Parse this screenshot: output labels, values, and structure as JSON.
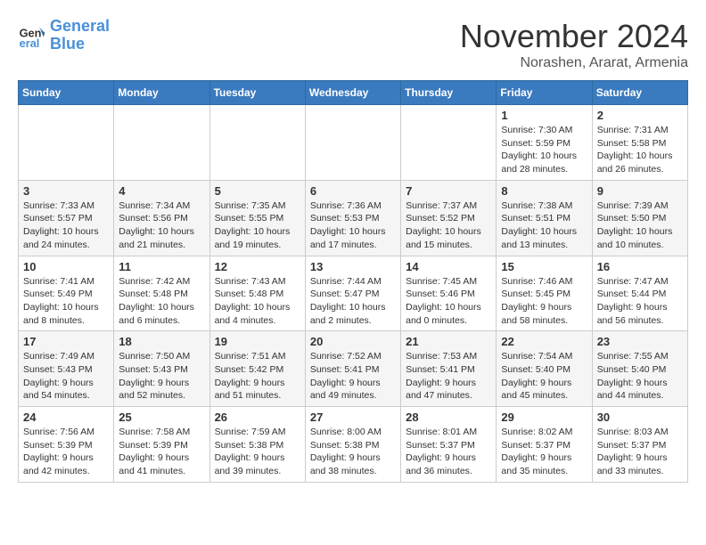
{
  "logo": {
    "line1": "General",
    "line2": "Blue"
  },
  "title": "November 2024",
  "location": "Norashen, Ararat, Armenia",
  "days_header": [
    "Sunday",
    "Monday",
    "Tuesday",
    "Wednesday",
    "Thursday",
    "Friday",
    "Saturday"
  ],
  "weeks": [
    [
      {
        "day": "",
        "info": ""
      },
      {
        "day": "",
        "info": ""
      },
      {
        "day": "",
        "info": ""
      },
      {
        "day": "",
        "info": ""
      },
      {
        "day": "",
        "info": ""
      },
      {
        "day": "1",
        "info": "Sunrise: 7:30 AM\nSunset: 5:59 PM\nDaylight: 10 hours\nand 28 minutes."
      },
      {
        "day": "2",
        "info": "Sunrise: 7:31 AM\nSunset: 5:58 PM\nDaylight: 10 hours\nand 26 minutes."
      }
    ],
    [
      {
        "day": "3",
        "info": "Sunrise: 7:33 AM\nSunset: 5:57 PM\nDaylight: 10 hours\nand 24 minutes."
      },
      {
        "day": "4",
        "info": "Sunrise: 7:34 AM\nSunset: 5:56 PM\nDaylight: 10 hours\nand 21 minutes."
      },
      {
        "day": "5",
        "info": "Sunrise: 7:35 AM\nSunset: 5:55 PM\nDaylight: 10 hours\nand 19 minutes."
      },
      {
        "day": "6",
        "info": "Sunrise: 7:36 AM\nSunset: 5:53 PM\nDaylight: 10 hours\nand 17 minutes."
      },
      {
        "day": "7",
        "info": "Sunrise: 7:37 AM\nSunset: 5:52 PM\nDaylight: 10 hours\nand 15 minutes."
      },
      {
        "day": "8",
        "info": "Sunrise: 7:38 AM\nSunset: 5:51 PM\nDaylight: 10 hours\nand 13 minutes."
      },
      {
        "day": "9",
        "info": "Sunrise: 7:39 AM\nSunset: 5:50 PM\nDaylight: 10 hours\nand 10 minutes."
      }
    ],
    [
      {
        "day": "10",
        "info": "Sunrise: 7:41 AM\nSunset: 5:49 PM\nDaylight: 10 hours\nand 8 minutes."
      },
      {
        "day": "11",
        "info": "Sunrise: 7:42 AM\nSunset: 5:48 PM\nDaylight: 10 hours\nand 6 minutes."
      },
      {
        "day": "12",
        "info": "Sunrise: 7:43 AM\nSunset: 5:48 PM\nDaylight: 10 hours\nand 4 minutes."
      },
      {
        "day": "13",
        "info": "Sunrise: 7:44 AM\nSunset: 5:47 PM\nDaylight: 10 hours\nand 2 minutes."
      },
      {
        "day": "14",
        "info": "Sunrise: 7:45 AM\nSunset: 5:46 PM\nDaylight: 10 hours\nand 0 minutes."
      },
      {
        "day": "15",
        "info": "Sunrise: 7:46 AM\nSunset: 5:45 PM\nDaylight: 9 hours\nand 58 minutes."
      },
      {
        "day": "16",
        "info": "Sunrise: 7:47 AM\nSunset: 5:44 PM\nDaylight: 9 hours\nand 56 minutes."
      }
    ],
    [
      {
        "day": "17",
        "info": "Sunrise: 7:49 AM\nSunset: 5:43 PM\nDaylight: 9 hours\nand 54 minutes."
      },
      {
        "day": "18",
        "info": "Sunrise: 7:50 AM\nSunset: 5:43 PM\nDaylight: 9 hours\nand 52 minutes."
      },
      {
        "day": "19",
        "info": "Sunrise: 7:51 AM\nSunset: 5:42 PM\nDaylight: 9 hours\nand 51 minutes."
      },
      {
        "day": "20",
        "info": "Sunrise: 7:52 AM\nSunset: 5:41 PM\nDaylight: 9 hours\nand 49 minutes."
      },
      {
        "day": "21",
        "info": "Sunrise: 7:53 AM\nSunset: 5:41 PM\nDaylight: 9 hours\nand 47 minutes."
      },
      {
        "day": "22",
        "info": "Sunrise: 7:54 AM\nSunset: 5:40 PM\nDaylight: 9 hours\nand 45 minutes."
      },
      {
        "day": "23",
        "info": "Sunrise: 7:55 AM\nSunset: 5:40 PM\nDaylight: 9 hours\nand 44 minutes."
      }
    ],
    [
      {
        "day": "24",
        "info": "Sunrise: 7:56 AM\nSunset: 5:39 PM\nDaylight: 9 hours\nand 42 minutes."
      },
      {
        "day": "25",
        "info": "Sunrise: 7:58 AM\nSunset: 5:39 PM\nDaylight: 9 hours\nand 41 minutes."
      },
      {
        "day": "26",
        "info": "Sunrise: 7:59 AM\nSunset: 5:38 PM\nDaylight: 9 hours\nand 39 minutes."
      },
      {
        "day": "27",
        "info": "Sunrise: 8:00 AM\nSunset: 5:38 PM\nDaylight: 9 hours\nand 38 minutes."
      },
      {
        "day": "28",
        "info": "Sunrise: 8:01 AM\nSunset: 5:37 PM\nDaylight: 9 hours\nand 36 minutes."
      },
      {
        "day": "29",
        "info": "Sunrise: 8:02 AM\nSunset: 5:37 PM\nDaylight: 9 hours\nand 35 minutes."
      },
      {
        "day": "30",
        "info": "Sunrise: 8:03 AM\nSunset: 5:37 PM\nDaylight: 9 hours\nand 33 minutes."
      }
    ]
  ]
}
